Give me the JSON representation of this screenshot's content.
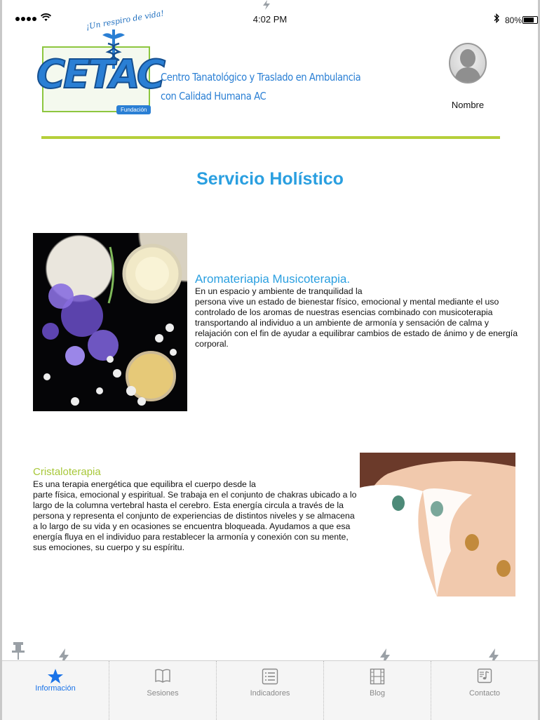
{
  "status_bar": {
    "time": "4:02 PM",
    "battery": "80%",
    "icons": [
      "signal-icon",
      "wifi-icon",
      "bluetooth-icon",
      "battery-icon"
    ]
  },
  "header": {
    "logo_text": "CETAC",
    "logo_tagline": "¡Un respiro de vida!",
    "logo_badge": "Fundación",
    "org_name_line1": "Centro Tanatológico y Traslado en Ambulancia",
    "org_name_line2": "con Calidad Humana AC",
    "user_name": "Nombre"
  },
  "page": {
    "title": "Servicio Holístico"
  },
  "sections": [
    {
      "title": "Aromateriapia Musicoterapia.",
      "body_line1": "En un espacio y ambiente de tranquilidad la",
      "body_rest": "persona vive un estado de bienestar físico, emocional y mental mediante el uso controlado de los aromas de nuestras esencias combinado con musicoterapia transportando al individuo a un ambiente de armonía y sensación de calma y relajación con el fin de ayudar a equilibrar cambios de estado de ánimo y de energía corporal."
    },
    {
      "title": "Cristaloterapia",
      "body_line1": "Es una terapia energética que equilibra el cuerpo desde la",
      "body_rest": "parte física, emocional y espiritual. Se trabaja en el conjunto de chakras ubicado a lo largo de la columna vertebral hasta el cerebro. Esta energía circula a través de la persona y representa el conjunto de experiencias de distintos niveles y se almacena a lo largo de su vida y en ocasiones se encuentra bloqueada. Ayudamos a que esa energía fluya en el individuo para restablecer la armonía y conexión con su mente, sus emociones, su cuerpo y su espíritu."
    }
  ],
  "tabs": [
    {
      "label": "Información",
      "icon": "star-icon",
      "active": true
    },
    {
      "label": "Sesiones",
      "icon": "book-icon",
      "active": false
    },
    {
      "label": "Indicadores",
      "icon": "list-icon",
      "active": false
    },
    {
      "label": "Blog",
      "icon": "film-icon",
      "active": false
    },
    {
      "label": "Contacto",
      "icon": "music-note-icon",
      "active": false
    }
  ],
  "colors": {
    "accent_blue": "#2a9fe0",
    "accent_green": "#b5cf3a",
    "tab_active": "#1a73e8"
  }
}
